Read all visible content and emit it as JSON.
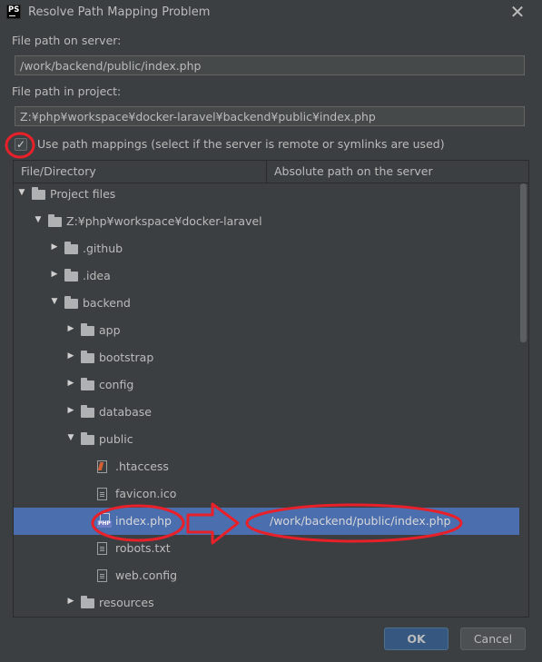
{
  "dialog": {
    "app_icon_text": "PS",
    "title": "Resolve Path Mapping Problem",
    "close_glyph": "✕"
  },
  "server_path": {
    "label": "File path on server:",
    "value": "/work/backend/public/index.php"
  },
  "project_path": {
    "label": "File path in project:",
    "value": "Z:¥php¥workspace¥docker-laravel¥backend¥public¥index.php"
  },
  "use_mappings": {
    "checked": true,
    "check_glyph": "✓",
    "label": "Use path mappings (select if the server is remote or symlinks are used)"
  },
  "table": {
    "columns": [
      "File/Directory",
      "Absolute path on the server"
    ],
    "rows": [
      {
        "name": "Project files",
        "type": "folder",
        "expanded": true,
        "mapped": ""
      },
      {
        "name": "Z:¥php¥workspace¥docker-laravel",
        "type": "folder",
        "expanded": true,
        "mapped": ""
      },
      {
        "name": ".github",
        "type": "folder",
        "expanded": false,
        "mapped": ""
      },
      {
        "name": ".idea",
        "type": "folder",
        "expanded": false,
        "mapped": ""
      },
      {
        "name": "backend",
        "type": "folder",
        "expanded": true,
        "mapped": ""
      },
      {
        "name": "app",
        "type": "folder",
        "expanded": false,
        "mapped": ""
      },
      {
        "name": "bootstrap",
        "type": "folder",
        "expanded": false,
        "mapped": ""
      },
      {
        "name": "config",
        "type": "folder",
        "expanded": false,
        "mapped": ""
      },
      {
        "name": "database",
        "type": "folder",
        "expanded": false,
        "mapped": ""
      },
      {
        "name": "public",
        "type": "folder",
        "expanded": true,
        "mapped": ""
      },
      {
        "name": ".htaccess",
        "type": "git-file",
        "mapped": ""
      },
      {
        "name": "favicon.ico",
        "type": "file",
        "mapped": ""
      },
      {
        "name": "index.php",
        "type": "php-file",
        "selected": true,
        "mapped": "/work/backend/public/index.php"
      },
      {
        "name": "robots.txt",
        "type": "file",
        "mapped": ""
      },
      {
        "name": "web.config",
        "type": "file",
        "mapped": ""
      },
      {
        "name": "resources",
        "type": "folder",
        "expanded": false,
        "mapped": ""
      }
    ]
  },
  "glyphs": {
    "expanded": "▼",
    "collapsed": "▶"
  },
  "buttons": {
    "ok": "OK",
    "cancel": "Cancel"
  },
  "colors": {
    "selection": "#4b6eaf",
    "annotation": "#e8202a",
    "ok_button": "#365880"
  },
  "icons": [
    "folder-icon",
    "file-icon",
    "php-file-icon",
    "git-file-icon",
    "checkbox-icon",
    "close-icon"
  ]
}
